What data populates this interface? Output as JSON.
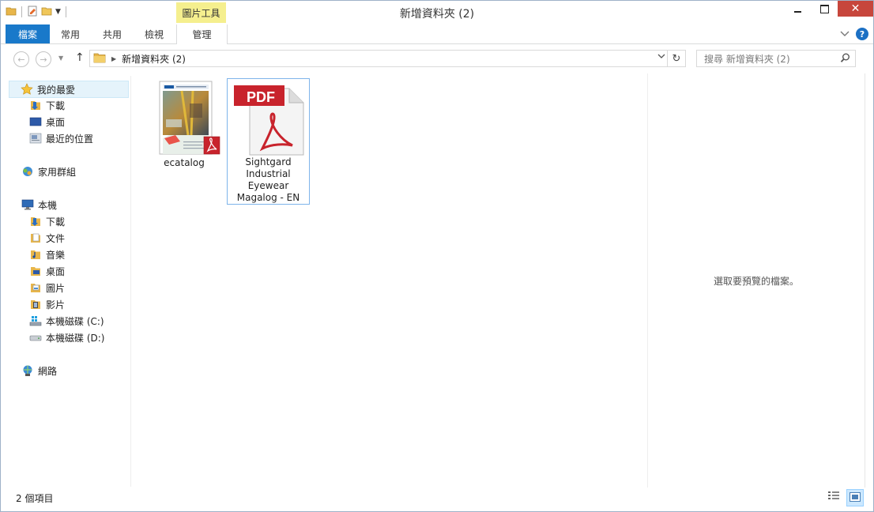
{
  "window": {
    "title": "新增資料夾 (2)"
  },
  "ribbon": {
    "context_header": "圖片工具",
    "tabs": [
      "檔案",
      "常用",
      "共用",
      "檢視",
      "管理"
    ]
  },
  "address": {
    "crumbs": [
      "新增資料夾 (2)"
    ],
    "search_placeholder": "搜尋 新增資料夾 (2)"
  },
  "navpane": {
    "favorites": {
      "label": "我的最愛",
      "items": [
        "下載",
        "桌面",
        "最近的位置"
      ]
    },
    "homegroup": "家用群組",
    "thispc": {
      "label": "本機",
      "items": [
        "下載",
        "文件",
        "音樂",
        "桌面",
        "圖片",
        "影片",
        "本機磁碟 (C:)",
        "本機磁碟 (D:)"
      ]
    },
    "network": "網路"
  },
  "files": [
    {
      "name": "ecatalog",
      "icon": "pdf-thumbnail-icon",
      "selected": false
    },
    {
      "name": "Sightgard Industrial Eyewear Magalog - EN",
      "name_lines": [
        "Sightgard",
        "Industrial",
        "Eyewear",
        "Magalog - EN"
      ],
      "icon": "pdf-icon",
      "selected": true
    }
  ],
  "preview": {
    "message": "選取要預覽的檔案。"
  },
  "status": {
    "item_count": "2 個項目"
  },
  "colors": {
    "file_tab": "#1979ca",
    "context_header": "#f5ef8e",
    "close_button": "#c7463c",
    "pdf_red": "#c8232c"
  }
}
